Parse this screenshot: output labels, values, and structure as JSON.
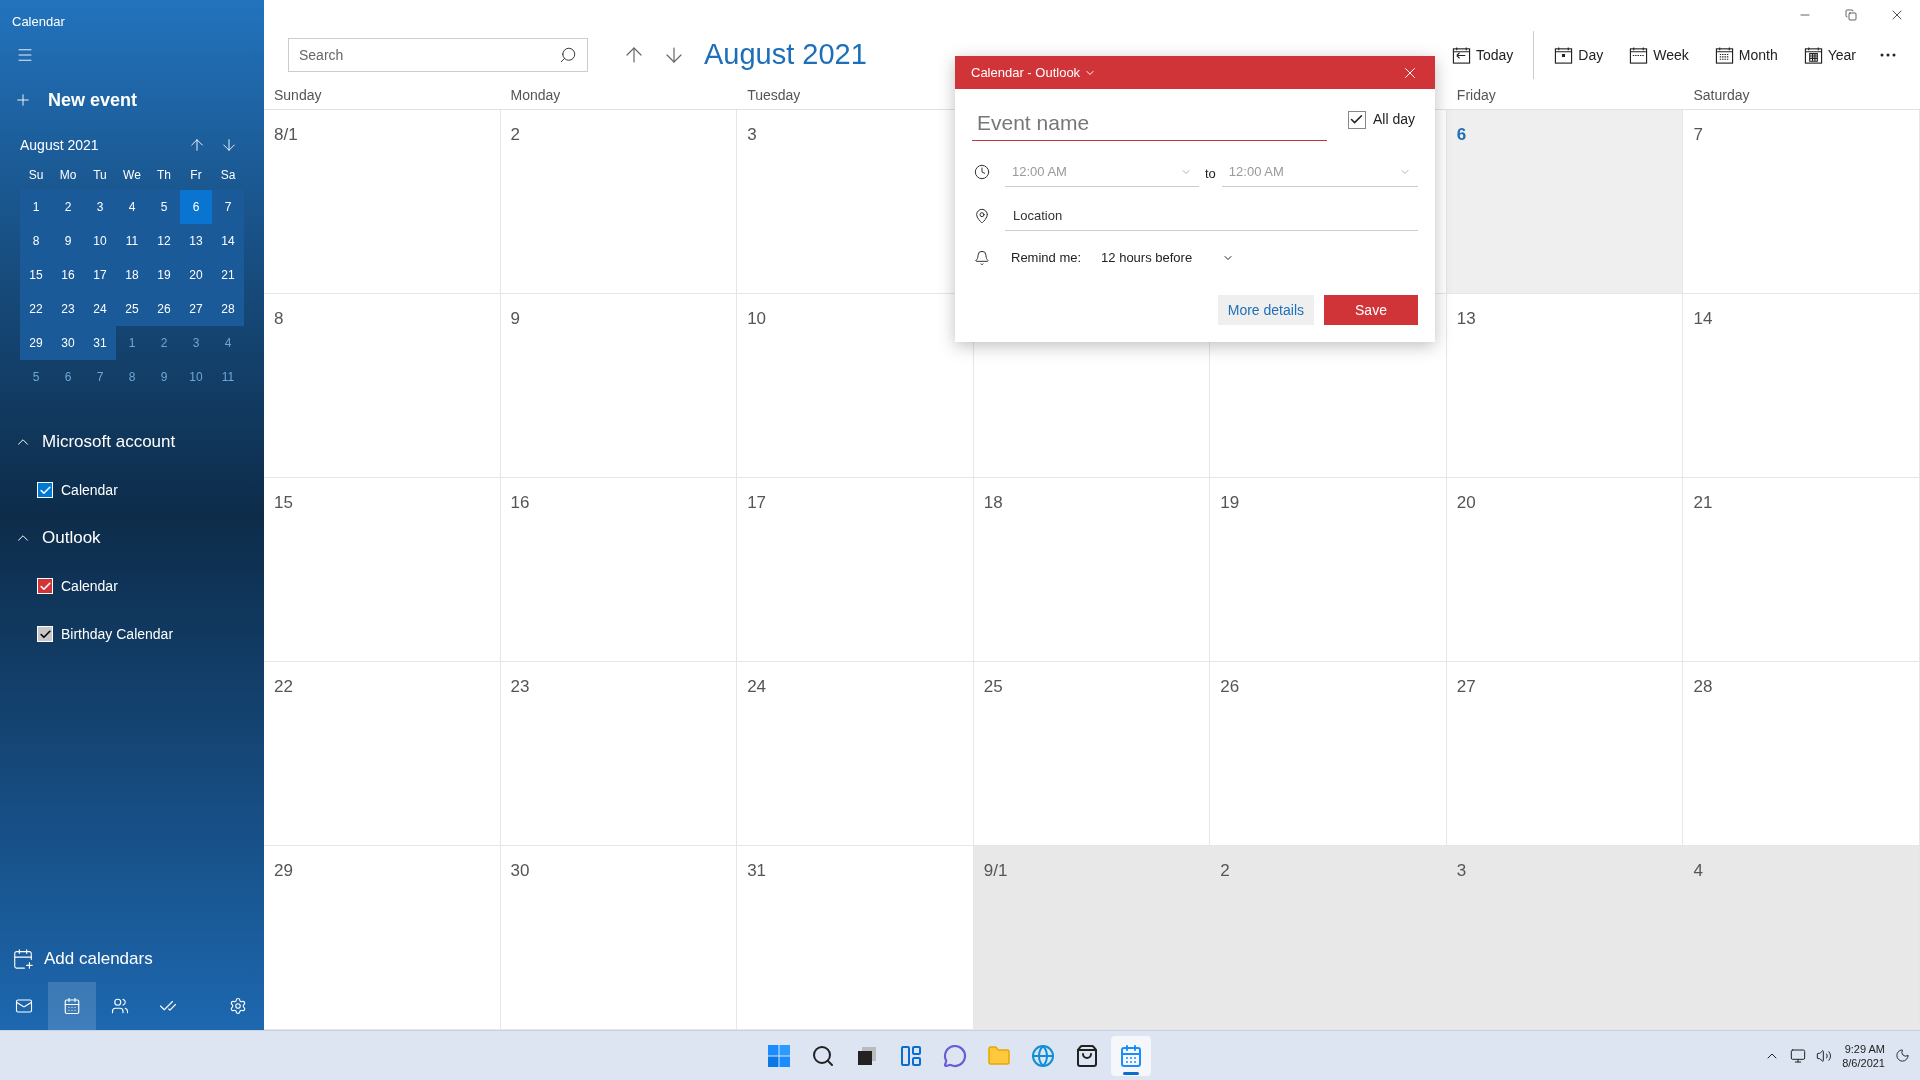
{
  "app_title": "Calendar",
  "sidebar": {
    "new_event": "New event",
    "mini_calendar": {
      "title": "August 2021",
      "weekdays": [
        "Su",
        "Mo",
        "Tu",
        "We",
        "Th",
        "Fr",
        "Sa"
      ],
      "weeks": [
        [
          {
            "day": "1",
            "other_month": false,
            "selected": false
          },
          {
            "day": "2",
            "other_month": false,
            "selected": false
          },
          {
            "day": "3",
            "other_month": false,
            "selected": false
          },
          {
            "day": "4",
            "other_month": false,
            "selected": false
          },
          {
            "day": "5",
            "other_month": false,
            "selected": false
          },
          {
            "day": "6",
            "other_month": false,
            "selected": true
          },
          {
            "day": "7",
            "other_month": false,
            "selected": false
          }
        ],
        [
          {
            "day": "8",
            "other_month": false,
            "selected": false
          },
          {
            "day": "9",
            "other_month": false,
            "selected": false
          },
          {
            "day": "10",
            "other_month": false,
            "selected": false
          },
          {
            "day": "11",
            "other_month": false,
            "selected": false
          },
          {
            "day": "12",
            "other_month": false,
            "selected": false
          },
          {
            "day": "13",
            "other_month": false,
            "selected": false
          },
          {
            "day": "14",
            "other_month": false,
            "selected": false
          }
        ],
        [
          {
            "day": "15",
            "other_month": false,
            "selected": false
          },
          {
            "day": "16",
            "other_month": false,
            "selected": false
          },
          {
            "day": "17",
            "other_month": false,
            "selected": false
          },
          {
            "day": "18",
            "other_month": false,
            "selected": false
          },
          {
            "day": "19",
            "other_month": false,
            "selected": false
          },
          {
            "day": "20",
            "other_month": false,
            "selected": false
          },
          {
            "day": "21",
            "other_month": false,
            "selected": false
          }
        ],
        [
          {
            "day": "22",
            "other_month": false,
            "selected": false
          },
          {
            "day": "23",
            "other_month": false,
            "selected": false
          },
          {
            "day": "24",
            "other_month": false,
            "selected": false
          },
          {
            "day": "25",
            "other_month": false,
            "selected": false
          },
          {
            "day": "26",
            "other_month": false,
            "selected": false
          },
          {
            "day": "27",
            "other_month": false,
            "selected": false
          },
          {
            "day": "28",
            "other_month": false,
            "selected": false
          }
        ],
        [
          {
            "day": "29",
            "other_month": false,
            "selected": false
          },
          {
            "day": "30",
            "other_month": false,
            "selected": false
          },
          {
            "day": "31",
            "other_month": false,
            "selected": false
          },
          {
            "day": "1",
            "other_month": true,
            "selected": false
          },
          {
            "day": "2",
            "other_month": true,
            "selected": false
          },
          {
            "day": "3",
            "other_month": true,
            "selected": false
          },
          {
            "day": "4",
            "other_month": true,
            "selected": false
          }
        ],
        [
          {
            "day": "5",
            "other_month": true,
            "selected": false
          },
          {
            "day": "6",
            "other_month": true,
            "selected": false
          },
          {
            "day": "7",
            "other_month": true,
            "selected": false
          },
          {
            "day": "8",
            "other_month": true,
            "selected": false
          },
          {
            "day": "9",
            "other_month": true,
            "selected": false
          },
          {
            "day": "10",
            "other_month": true,
            "selected": false
          },
          {
            "day": "11",
            "other_month": true,
            "selected": false
          }
        ]
      ]
    },
    "accounts": [
      {
        "name": "Microsoft account",
        "expanded": true,
        "calendars": [
          {
            "name": "Calendar",
            "checked": true,
            "color": "#0078d4"
          }
        ]
      },
      {
        "name": "Outlook",
        "expanded": true,
        "calendars": [
          {
            "name": "Calendar",
            "checked": true,
            "color": "#d13438"
          },
          {
            "name": "Birthday Calendar",
            "checked": true,
            "color": "#c8c8c8"
          }
        ]
      }
    ],
    "add_calendars": "Add calendars",
    "nav": [
      {
        "kind": "mail",
        "selected": false
      },
      {
        "kind": "calendar",
        "selected": true
      },
      {
        "kind": "people",
        "selected": false
      },
      {
        "kind": "todo",
        "selected": false
      },
      {
        "kind": "settings",
        "selected": false
      }
    ]
  },
  "toolbar": {
    "search": {
      "placeholder": "Search"
    },
    "month_title": "August 2021",
    "views": [
      {
        "kind": "today",
        "label": "Today"
      },
      {
        "kind": "day",
        "label": "Day"
      },
      {
        "kind": "week",
        "label": "Week"
      },
      {
        "kind": "month",
        "label": "Month"
      },
      {
        "kind": "year",
        "label": "Year"
      }
    ]
  },
  "month_grid": {
    "weekdays": {
      "left": [
        "Sunday",
        "Monday",
        "Tuesday"
      ],
      "right": [
        "Friday",
        "Saturday"
      ]
    },
    "weeks": [
      {
        "left": [
          {
            "day": "8/1",
            "today": false,
            "other_month": false
          },
          {
            "day": "2",
            "today": false,
            "other_month": false
          },
          {
            "day": "3",
            "today": false,
            "other_month": false
          }
        ],
        "right": [
          {
            "day": "6",
            "today": true,
            "other_month": false
          },
          {
            "day": "7",
            "today": false,
            "other_month": false
          }
        ]
      },
      {
        "left": [
          {
            "day": "8",
            "today": false,
            "other_month": false
          },
          {
            "day": "9",
            "today": false,
            "other_month": false
          },
          {
            "day": "10",
            "today": false,
            "other_month": false
          }
        ],
        "right": [
          {
            "day": "13",
            "today": false,
            "other_month": false
          },
          {
            "day": "14",
            "today": false,
            "other_month": false
          }
        ]
      },
      {
        "left": [
          {
            "day": "15",
            "today": false,
            "other_month": false
          },
          {
            "day": "16",
            "today": false,
            "other_month": false
          },
          {
            "day": "17",
            "today": false,
            "other_month": false
          }
        ],
        "middle": [
          {
            "day": "18",
            "today": false,
            "other_month": false
          },
          {
            "day": "19",
            "today": false,
            "other_month": false
          }
        ],
        "right": [
          {
            "day": "20",
            "today": false,
            "other_month": false
          },
          {
            "day": "21",
            "today": false,
            "other_month": false
          }
        ]
      },
      {
        "left": [
          {
            "day": "22",
            "today": false,
            "other_month": false
          },
          {
            "day": "23",
            "today": false,
            "other_month": false
          },
          {
            "day": "24",
            "today": false,
            "other_month": false
          }
        ],
        "middle": [
          {
            "day": "25",
            "today": false,
            "other_month": false
          },
          {
            "day": "26",
            "today": false,
            "other_month": false
          }
        ],
        "right": [
          {
            "day": "27",
            "today": false,
            "other_month": false
          },
          {
            "day": "28",
            "today": false,
            "other_month": false
          }
        ]
      },
      {
        "left": [
          {
            "day": "29",
            "today": false,
            "other_month": false
          },
          {
            "day": "30",
            "today": false,
            "other_month": false
          },
          {
            "day": "31",
            "today": false,
            "other_month": false
          }
        ],
        "middle": [
          {
            "day": "9/1",
            "today": false,
            "other_month": true
          },
          {
            "day": "2",
            "today": false,
            "other_month": true
          }
        ],
        "right": [
          {
            "day": "3",
            "today": false,
            "other_month": true
          },
          {
            "day": "4",
            "today": false,
            "other_month": true
          }
        ]
      }
    ]
  },
  "popup": {
    "calendar": "Calendar - Outlook",
    "event_name": {
      "placeholder": "Event name"
    },
    "all_day": {
      "label": "All day",
      "checked": true
    },
    "start": {
      "value": "12:00 AM",
      "disabled": true
    },
    "to": "to",
    "end": {
      "value": "12:00 AM",
      "disabled": true
    },
    "location": {
      "placeholder": "Location"
    },
    "remind_label": "Remind me:",
    "remind_value": "12 hours before",
    "buttons": [
      {
        "kind": "secondary",
        "label": "More details"
      },
      {
        "kind": "primary",
        "label": "Save"
      }
    ]
  },
  "taskbar": {
    "apps": [
      {
        "kind": "start",
        "active": false
      },
      {
        "kind": "search",
        "active": false
      },
      {
        "kind": "taskview",
        "active": false
      },
      {
        "kind": "widgets",
        "active": false
      },
      {
        "kind": "chat",
        "active": false
      },
      {
        "kind": "explorer",
        "active": false
      },
      {
        "kind": "browser",
        "active": false
      },
      {
        "kind": "store",
        "active": false
      },
      {
        "kind": "calendar",
        "active": true
      }
    ],
    "time": "9:29 AM",
    "date": "8/6/2021"
  }
}
